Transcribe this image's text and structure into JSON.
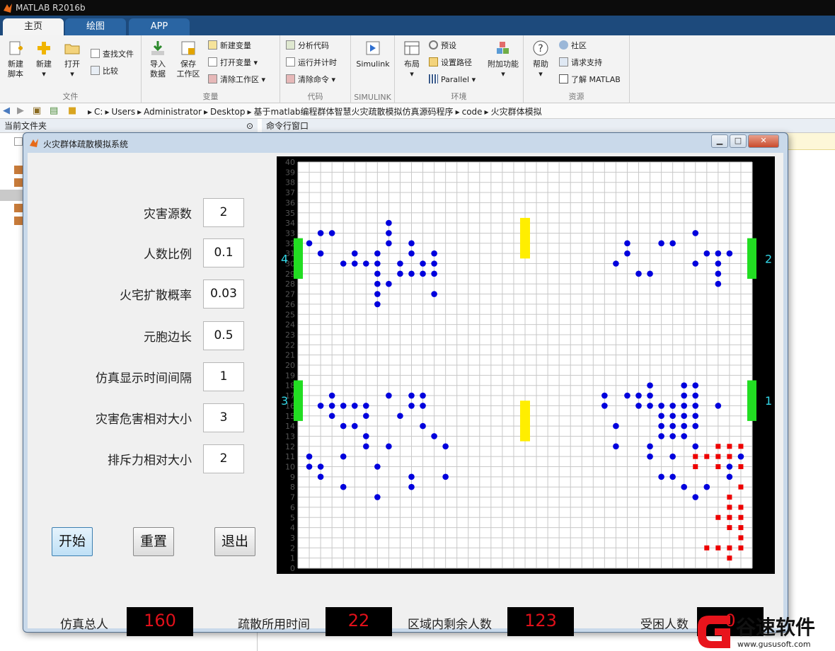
{
  "window": {
    "title": "MATLAB R2016b"
  },
  "tabs": [
    "主页",
    "绘图",
    "APP"
  ],
  "ribbon": {
    "file": {
      "label": "文件",
      "new_script": [
        "新建",
        "脚本"
      ],
      "new": "新建",
      "open": "打开",
      "find_files": "查找文件",
      "compare": "比较"
    },
    "variable": {
      "label": "变量",
      "import": [
        "导入",
        "数据"
      ],
      "save": [
        "保存",
        "工作区"
      ],
      "new_var": "新建变量",
      "open_var": "打开变量",
      "clear_ws": "清除工作区"
    },
    "code": {
      "label": "代码",
      "analyze": "分析代码",
      "run_time": "运行并计时",
      "clear_cmd": "清除命令"
    },
    "simulink": {
      "label": "SIMULINK",
      "simulink": "Simulink"
    },
    "env": {
      "label": "环境",
      "layout": "布局",
      "prefs": "预设",
      "set_path": "设置路径",
      "parallel": "Parallel",
      "addons": "附加功能"
    },
    "resources": {
      "label": "资源",
      "help": "帮助",
      "community": "社区",
      "support": "请求支持",
      "learn": "了解 MATLAB"
    }
  },
  "address": {
    "crumbs": [
      "C:",
      "Users",
      "Administrator",
      "Desktop",
      "基于matlab编程群体智慧火灾疏散模拟仿真源码程序",
      "code",
      "火灾群体模拟"
    ]
  },
  "panes": {
    "current_folder": "当前文件夹",
    "command_window": "命令行窗口"
  },
  "dialog": {
    "title": "火灾群体疏散模拟系统",
    "params": [
      {
        "label": "灾害源数",
        "value": "2"
      },
      {
        "label": "人数比例",
        "value": "0.1"
      },
      {
        "label": "火宅扩散概率",
        "value": "0.03"
      },
      {
        "label": "元胞边长",
        "value": "0.5"
      },
      {
        "label": "仿真显示时间间隔",
        "value": "1"
      },
      {
        "label": "灾害危害相对大小",
        "value": "3"
      },
      {
        "label": "排斥力相对大小",
        "value": "2"
      }
    ],
    "buttons": {
      "start": "开始",
      "reset": "重置",
      "exit": "退出"
    },
    "stats": [
      {
        "label": "仿真总人",
        "value": "160"
      },
      {
        "label": "疏散所用时间",
        "value": "22"
      },
      {
        "label": "区域内剩余人数",
        "value": "123"
      },
      {
        "label": "受困人数",
        "value": "0"
      }
    ]
  },
  "watermark": {
    "name": "谷速软件",
    "url": "www.gususoft.com"
  },
  "colors": {
    "person": "#0000dd",
    "fire": "#ee0000",
    "exit": "#22dd22",
    "hazard": "#ffee00",
    "lcd_text": "#e0101a"
  },
  "chart_data": {
    "type": "scatter",
    "xlim": [
      0,
      40
    ],
    "ylim": [
      0,
      40
    ],
    "y_ticks": [
      0,
      1,
      2,
      3,
      4,
      5,
      6,
      7,
      8,
      9,
      10,
      11,
      12,
      13,
      14,
      15,
      16,
      17,
      18,
      19,
      20,
      21,
      22,
      23,
      24,
      25,
      26,
      27,
      28,
      29,
      30,
      31,
      32,
      33,
      34,
      35,
      36,
      37,
      38,
      39,
      40
    ],
    "grid": true,
    "exits": [
      {
        "label": "4",
        "side": "left",
        "y_range": [
          28.5,
          32.5
        ]
      },
      {
        "label": "3",
        "side": "left",
        "y_range": [
          14.5,
          18.5
        ]
      },
      {
        "label": "2",
        "side": "right",
        "y_range": [
          28.5,
          32.5
        ]
      },
      {
        "label": "1",
        "side": "right",
        "y_range": [
          14.5,
          18.5
        ]
      }
    ],
    "hazards": [
      {
        "x": 20,
        "y_range": [
          30.5,
          34.5
        ]
      },
      {
        "x": 20,
        "y_range": [
          12.5,
          16.5
        ]
      }
    ],
    "persons": [
      [
        1,
        32
      ],
      [
        2,
        33
      ],
      [
        3,
        33
      ],
      [
        2,
        31
      ],
      [
        4,
        30
      ],
      [
        5,
        31
      ],
      [
        5,
        30
      ],
      [
        6,
        30
      ],
      [
        7,
        31
      ],
      [
        7,
        30
      ],
      [
        7,
        29
      ],
      [
        7,
        28
      ],
      [
        7,
        27
      ],
      [
        7,
        26
      ],
      [
        8,
        34
      ],
      [
        8,
        33
      ],
      [
        8,
        32
      ],
      [
        8,
        28
      ],
      [
        9,
        30
      ],
      [
        9,
        29
      ],
      [
        10,
        32
      ],
      [
        10,
        31
      ],
      [
        10,
        29
      ],
      [
        11,
        30
      ],
      [
        11,
        29
      ],
      [
        12,
        31
      ],
      [
        12,
        30
      ],
      [
        12,
        29
      ],
      [
        12,
        27
      ],
      [
        29,
        32
      ],
      [
        29,
        31
      ],
      [
        28,
        30
      ],
      [
        30,
        29
      ],
      [
        31,
        29
      ],
      [
        32,
        32
      ],
      [
        33,
        32
      ],
      [
        35,
        33
      ],
      [
        35,
        30
      ],
      [
        36,
        31
      ],
      [
        37,
        31
      ],
      [
        37,
        30
      ],
      [
        37,
        29
      ],
      [
        37,
        28
      ],
      [
        38,
        31
      ],
      [
        1,
        11
      ],
      [
        1,
        10
      ],
      [
        2,
        10
      ],
      [
        2,
        9
      ],
      [
        2,
        16
      ],
      [
        3,
        17
      ],
      [
        3,
        16
      ],
      [
        3,
        15
      ],
      [
        4,
        16
      ],
      [
        4,
        14
      ],
      [
        4,
        11
      ],
      [
        4,
        8
      ],
      [
        5,
        16
      ],
      [
        5,
        14
      ],
      [
        6,
        16
      ],
      [
        6,
        15
      ],
      [
        6,
        13
      ],
      [
        6,
        12
      ],
      [
        7,
        10
      ],
      [
        7,
        7
      ],
      [
        8,
        17
      ],
      [
        8,
        12
      ],
      [
        9,
        15
      ],
      [
        10,
        17
      ],
      [
        10,
        16
      ],
      [
        10,
        9
      ],
      [
        10,
        8
      ],
      [
        11,
        17
      ],
      [
        11,
        16
      ],
      [
        11,
        14
      ],
      [
        12,
        13
      ],
      [
        13,
        12
      ],
      [
        13,
        9
      ],
      [
        27,
        17
      ],
      [
        27,
        16
      ],
      [
        28,
        14
      ],
      [
        28,
        12
      ],
      [
        29,
        17
      ],
      [
        30,
        17
      ],
      [
        30,
        16
      ],
      [
        31,
        18
      ],
      [
        31,
        17
      ],
      [
        31,
        16
      ],
      [
        31,
        12
      ],
      [
        31,
        11
      ],
      [
        32,
        16
      ],
      [
        32,
        15
      ],
      [
        32,
        14
      ],
      [
        32,
        13
      ],
      [
        32,
        9
      ],
      [
        33,
        16
      ],
      [
        33,
        15
      ],
      [
        33,
        14
      ],
      [
        33,
        13
      ],
      [
        33,
        9
      ],
      [
        33,
        11
      ],
      [
        34,
        18
      ],
      [
        34,
        17
      ],
      [
        34,
        16
      ],
      [
        34,
        15
      ],
      [
        34,
        14
      ],
      [
        34,
        13
      ],
      [
        34,
        8
      ],
      [
        35,
        18
      ],
      [
        35,
        17
      ],
      [
        35,
        16
      ],
      [
        35,
        15
      ],
      [
        35,
        14
      ],
      [
        35,
        12
      ],
      [
        35,
        7
      ],
      [
        36,
        8
      ],
      [
        37,
        16
      ],
      [
        38,
        10
      ],
      [
        38,
        9
      ],
      [
        39,
        11
      ]
    ],
    "fire": [
      [
        35,
        11
      ],
      [
        35,
        10
      ],
      [
        36,
        11
      ],
      [
        37,
        12
      ],
      [
        37,
        11
      ],
      [
        37,
        10
      ],
      [
        38,
        12
      ],
      [
        38,
        11
      ],
      [
        39,
        12
      ],
      [
        39,
        10
      ],
      [
        39,
        8
      ],
      [
        38,
        7
      ],
      [
        39,
        6
      ],
      [
        38,
        6
      ],
      [
        38,
        5
      ],
      [
        39,
        5
      ],
      [
        37,
        5
      ],
      [
        38,
        4
      ],
      [
        39,
        4
      ],
      [
        39,
        3
      ],
      [
        36,
        2
      ],
      [
        37,
        2
      ],
      [
        38,
        2
      ],
      [
        39,
        2
      ],
      [
        38,
        1
      ]
    ]
  }
}
